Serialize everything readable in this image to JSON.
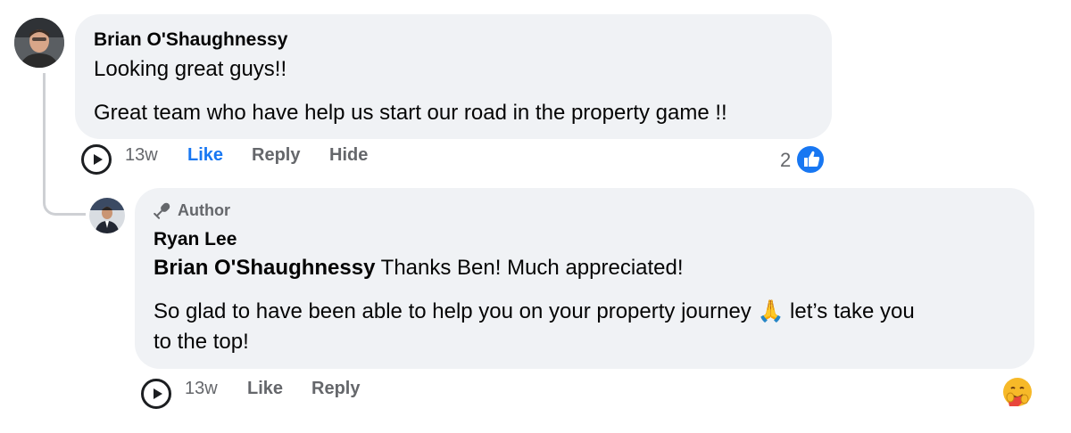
{
  "comment1": {
    "author": "Brian O'Shaughnessy",
    "line1": "Looking great guys!!",
    "line2": "Great team who have help us start our road in the property game !!",
    "time": "13w",
    "like": "Like",
    "reply": "Reply",
    "hide": "Hide",
    "reaction_count": "2",
    "reaction_icon": "thumbs-up-icon",
    "like_color": "#1877f2"
  },
  "reply1": {
    "badge": "Author",
    "badge_icon": "microphone-icon",
    "author": "Ryan Lee",
    "mention": "Brian O'Shaughnessy",
    "line1_rest": " Thanks Ben! Much appreciated!",
    "line2_before": "So glad to have been able to help you on your property journey ",
    "line2_emoji": "🙏",
    "line2_after": " let’s take you",
    "line3": "to the top!",
    "time": "13w",
    "like": "Like",
    "reply": "Reply",
    "reaction_icon": "hug-emoji-icon"
  }
}
